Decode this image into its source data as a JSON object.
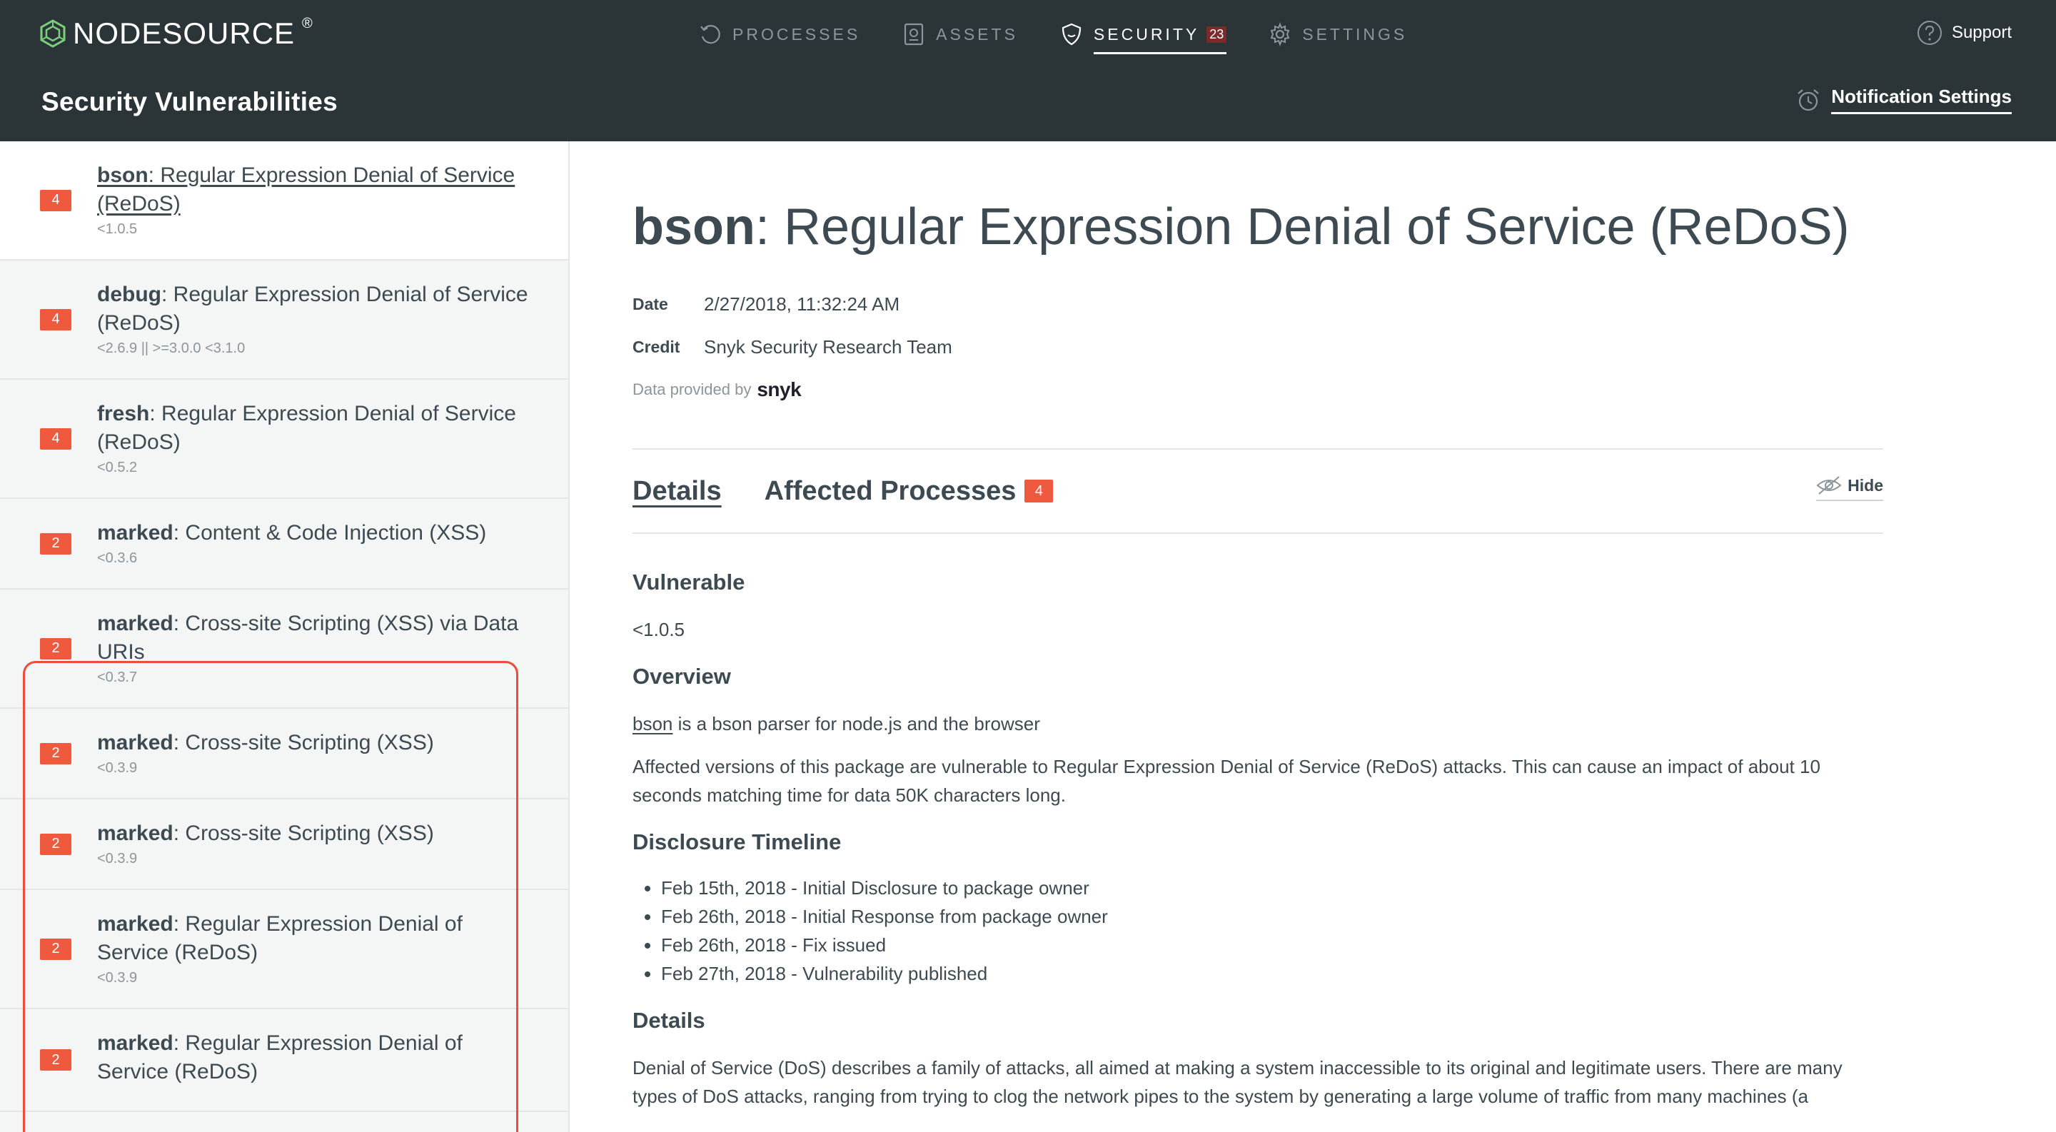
{
  "topbar": {
    "logo_text": "NODESOURCE",
    "logo_reg": "®",
    "nav": [
      {
        "label": "PROCESSES",
        "icon": "refresh-icon"
      },
      {
        "label": "ASSETS",
        "icon": "asset-icon"
      },
      {
        "label": "SECURITY",
        "icon": "shield-icon",
        "badge": "23"
      },
      {
        "label": "SETTINGS",
        "icon": "gear-icon"
      }
    ],
    "support_label": "Support",
    "page_title": "Security Vulnerabilities",
    "notification_label": "Notification Settings"
  },
  "sidebar": {
    "items": [
      {
        "severity": "4",
        "package": "bson",
        "title": ": Regular Expression Denial of Service (ReDoS)",
        "range": "<1.0.5"
      },
      {
        "severity": "4",
        "package": "debug",
        "title": ": Regular Expression Denial of Service (ReDoS)",
        "range": "<2.6.9 || >=3.0.0 <3.1.0"
      },
      {
        "severity": "4",
        "package": "fresh",
        "title": ": Regular Expression Denial of Service (ReDoS)",
        "range": "<0.5.2"
      },
      {
        "severity": "2",
        "package": "marked",
        "title": ": Content & Code Injection (XSS)",
        "range": "<0.3.6"
      },
      {
        "severity": "2",
        "package": "marked",
        "title": ": Cross-site Scripting (XSS) via Data URIs",
        "range": "<0.3.7"
      },
      {
        "severity": "2",
        "package": "marked",
        "title": ": Cross-site Scripting (XSS)",
        "range": "<0.3.9"
      },
      {
        "severity": "2",
        "package": "marked",
        "title": ": Cross-site Scripting (XSS)",
        "range": "<0.3.9"
      },
      {
        "severity": "2",
        "package": "marked",
        "title": ": Regular Expression Denial of Service (ReDoS)",
        "range": "<0.3.9"
      },
      {
        "severity": "2",
        "package": "marked",
        "title": ": Regular Expression Denial of Service (ReDoS)",
        "range": ""
      }
    ]
  },
  "detail": {
    "package": "bson",
    "title": ": Regular Expression Denial of Service (ReDoS)",
    "date_label": "Date",
    "date_value": "2/27/2018, 11:32:24 AM",
    "credit_label": "Credit",
    "credit_value": "Snyk Security Research Team",
    "provided_by": "Data provided by",
    "provider": "snyk",
    "tabs": {
      "details": "Details",
      "affected": "Affected Processes",
      "affected_count": "4",
      "hide": "Hide"
    },
    "vulnerable_heading": "Vulnerable",
    "vulnerable_value": "<1.0.5",
    "overview_heading": "Overview",
    "overview_link": "bson",
    "overview_text": " is a bson parser for node.js and the browser",
    "overview_para2": "Affected versions of this package are vulnerable to Regular Expression Denial of Service (ReDoS) attacks. This can cause an impact of about 10 seconds matching time for data 50K characters long.",
    "timeline_heading": "Disclosure Timeline",
    "timeline": [
      "Feb 15th, 2018 - Initial Disclosure to package owner",
      "Feb 26th, 2018 - Initial Response from package owner",
      "Feb 26th, 2018 - Fix issued",
      "Feb 27th, 2018 - Vulnerability published"
    ],
    "details_heading": "Details",
    "details_para": "Denial of Service (DoS) describes a family of attacks, all aimed at making a system inaccessible to its original and legitimate users. There are many types of DoS attacks, ranging from trying to clog the network pipes to the system by generating a large volume of traffic from many machines (a"
  }
}
